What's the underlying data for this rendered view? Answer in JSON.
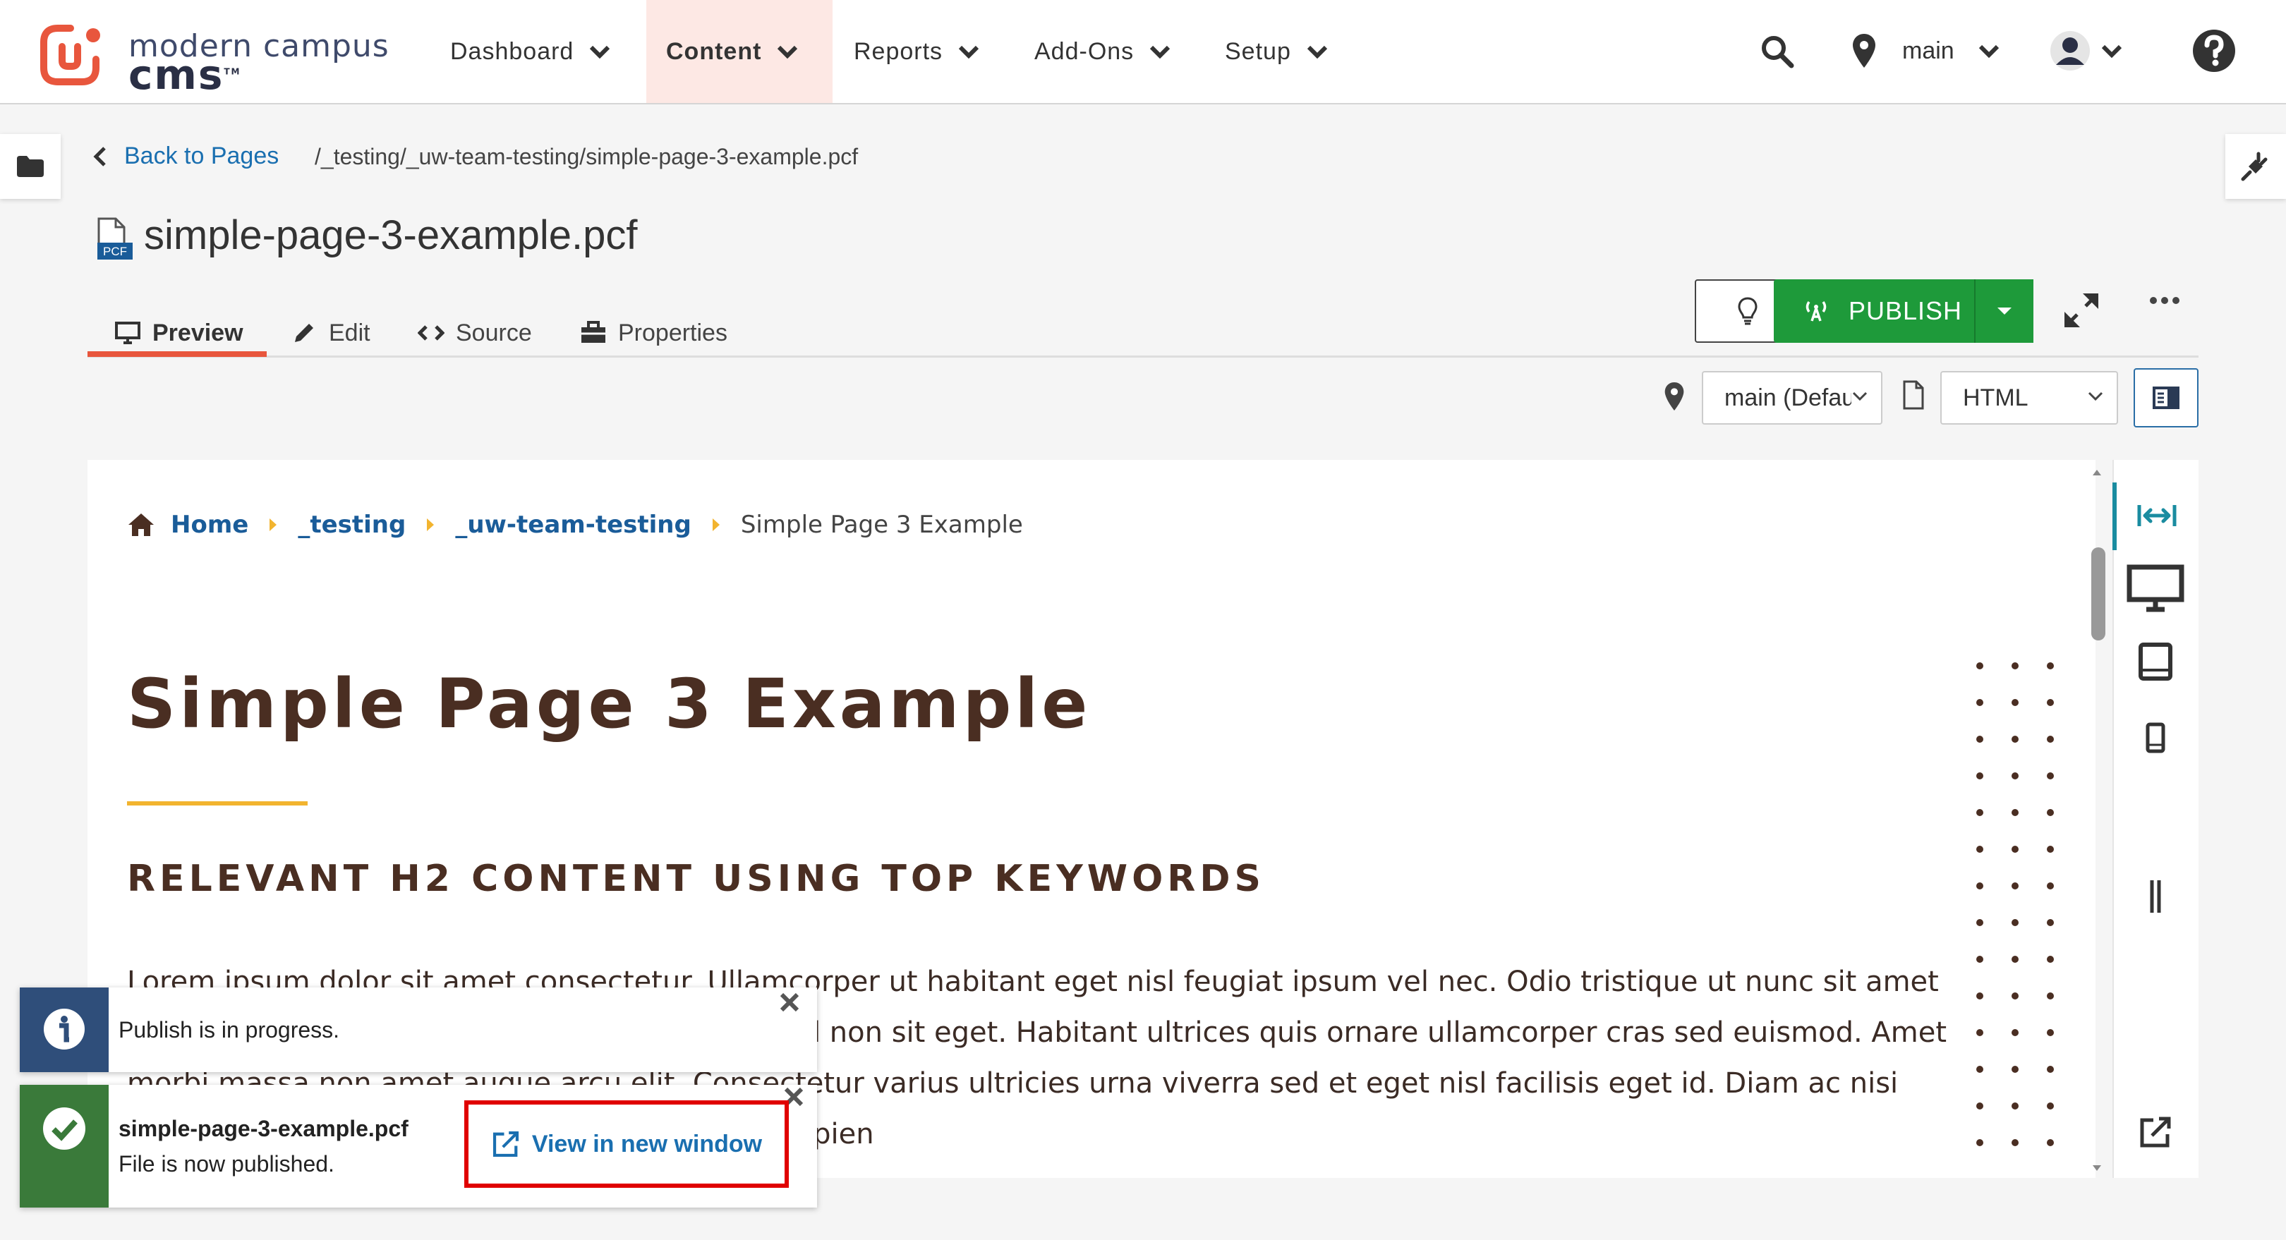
{
  "brand": {
    "line1": "modern campus",
    "line2": "cms",
    "tm": "TM",
    "accent": "#e8563d",
    "logo_color": "#3f4a6b"
  },
  "nav": {
    "items": [
      {
        "label": "Dashboard"
      },
      {
        "label": "Content",
        "active": true
      },
      {
        "label": "Reports"
      },
      {
        "label": "Add-Ons"
      },
      {
        "label": "Setup"
      }
    ],
    "site_label": "main"
  },
  "breadcrumb": {
    "back_label": "Back to Pages",
    "path": "/_testing/_uw-team-testing/simple-page-3-example.pcf"
  },
  "file": {
    "title": "simple-page-3-example.pcf",
    "badge": "PCF"
  },
  "tabs": [
    {
      "label": "Preview",
      "active": true,
      "icon": "monitor-icon"
    },
    {
      "label": "Edit",
      "icon": "pencil-icon"
    },
    {
      "label": "Source",
      "icon": "code-icon"
    },
    {
      "label": "Properties",
      "icon": "toolbox-icon"
    }
  ],
  "actions": {
    "publish_label": "PUBLISH",
    "publish_color": "#1e9a3a"
  },
  "selectors": {
    "branch_value": "main (Default)",
    "output_value": "HTML"
  },
  "preview": {
    "crumbs": [
      "Home",
      "_testing",
      "_uw-team-testing"
    ],
    "current": "Simple Page 3 Example",
    "title": "Simple Page 3 Example",
    "h2": "RELEVANT H2 CONTENT USING TOP KEYWORDS",
    "paragraph": "Lorem ipsum dolor sit amet consectetur. Ullamcorper ut habitant eget nisl feugiat ipsum vel nec. Odio tristique ut nunc sit amet lectus id erat ornare magna quam consectetur id non sit eget. Habitant ultrices quis ornare ullamcorper cras sed euismod. Amet morbi massa non amet augue arcu elit. Consectetur varius ultricies urna viverra sed et eget nisl facilisis eget id. Diam ac nisi pellentesque arcu curabitur rhoncus. Placerat sapien",
    "title_color": "#4a2e22",
    "rule_color": "#f2b42f"
  },
  "toasts": {
    "info_message": "Publish is in progress.",
    "success_file": "simple-page-3-example.pcf",
    "success_message": "File is now published.",
    "view_label": "View in new window",
    "info_color": "#2f4e7a",
    "success_color": "#3a7a3a"
  }
}
